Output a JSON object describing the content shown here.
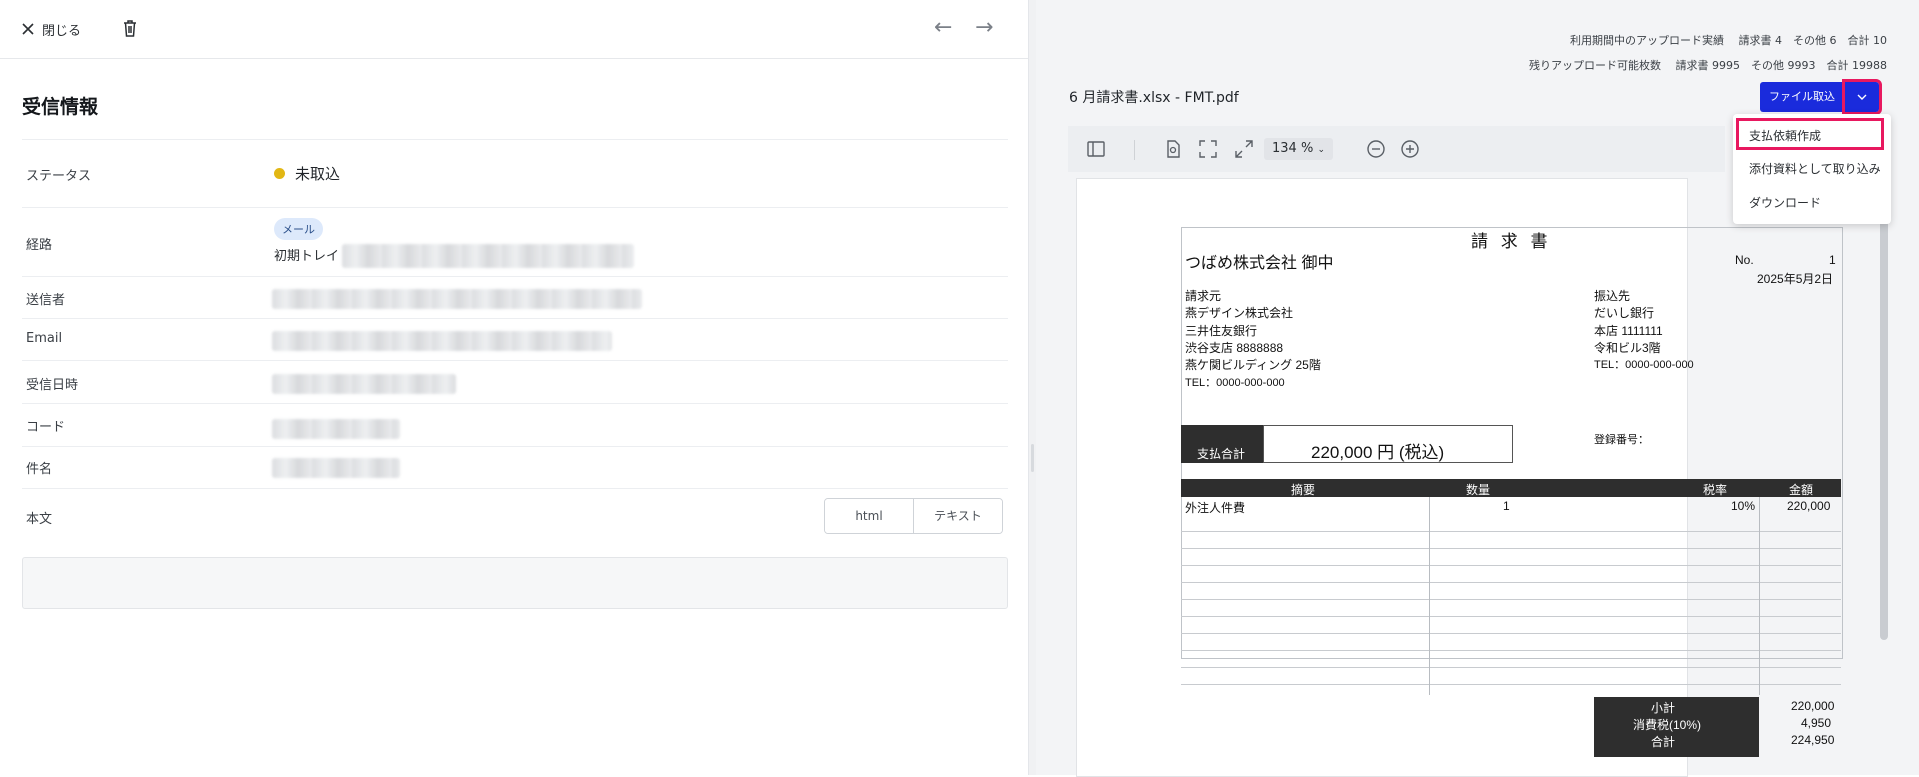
{
  "header": {
    "close_label": "閉じる",
    "prev_icon": "←",
    "next_icon": "→"
  },
  "section": {
    "title": "受信情報"
  },
  "fields": {
    "status_label": "ステータス",
    "status_value": "未取込",
    "status_color": "#e2b714",
    "route_label": "経路",
    "route_chip": "メール",
    "route_value": "初期トレイ",
    "sender_label": "送信者",
    "email_label": "Email",
    "received_label": "受信日時",
    "code_label": "コード",
    "subject_label": "件名",
    "body_label": "本文",
    "body_tabs": [
      "html",
      "テキスト"
    ]
  },
  "quota": {
    "line1": "利用期間中のアップロード実績　 請求書 4　その他 6　合計 10",
    "line2": "残りアップロード可能枚数　 請求書 9995　その他 9993　合計 19988"
  },
  "viewer": {
    "filename": "6 月請求書.xlsx - FMT.pdf",
    "import_label": "ファイル取込",
    "zoom": "134 %",
    "accent_color": "#1a2bdc",
    "highlight_color": "#e8185f",
    "menu": [
      "支払依頼作成",
      "添付資料として取り込み",
      "ダウンロード"
    ]
  },
  "invoice": {
    "heading": "請 求 書",
    "addressee": "つばめ株式会社  御中",
    "no_label": "No.",
    "no_value": "1",
    "date": "2025年5月2日",
    "billing_from_label": "請求元",
    "billing_from": [
      "燕デザイン株式会社",
      "三井住友銀行",
      "渋谷支店 8888888",
      "燕ケ関ビルディング  25階",
      "TEL：0000-000-000"
    ],
    "payee_label": "振込先",
    "payee": [
      "だいし銀行",
      "本店 1111111",
      "令和ビル3階",
      "TEL：0000-000-000"
    ],
    "total_label": "支払合計",
    "total_value": "220,000 円 (税込)",
    "reg_label": "登録番号：",
    "columns": [
      "摘要",
      "数量",
      "税率",
      "金額"
    ],
    "row": {
      "desc": "外注人件費",
      "qty": "1",
      "rate": "10%",
      "amount": "220,000"
    },
    "subtotal_label": "小計",
    "subtotal": "220,000",
    "tax_label": "消費税(10%)",
    "tax": "4,950",
    "sum_label": "合計",
    "sum": "224,950"
  }
}
